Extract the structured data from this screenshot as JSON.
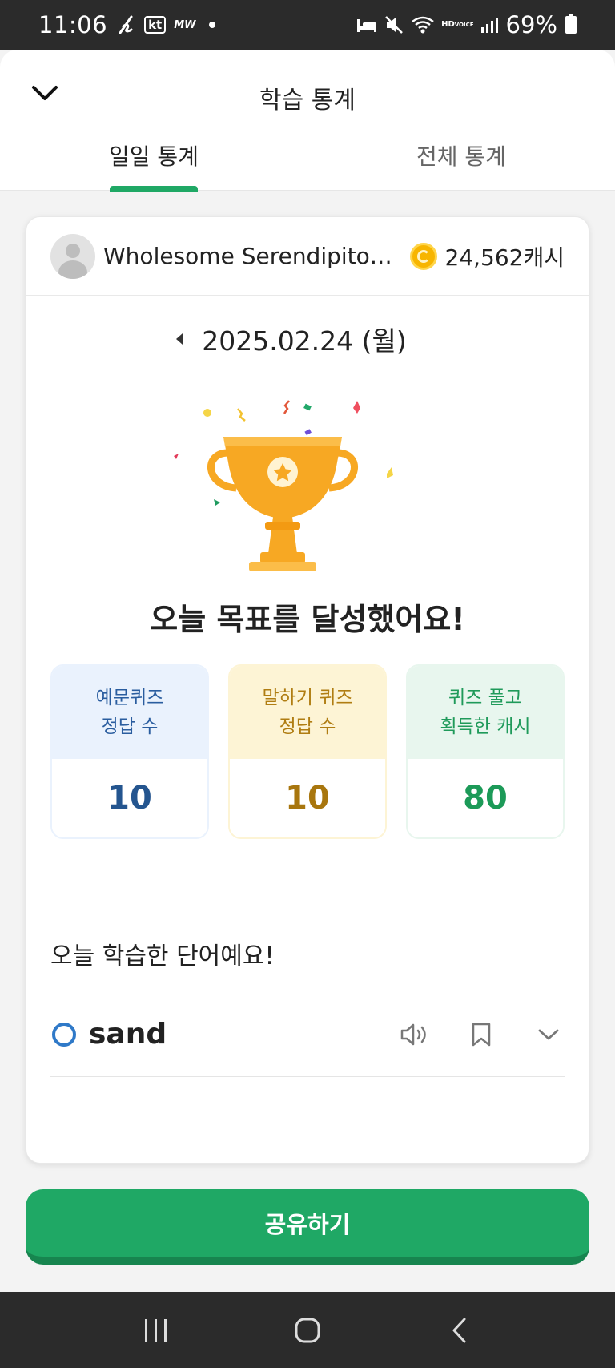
{
  "status_bar": {
    "time": "11:06",
    "carrier": "kt",
    "carrier_sub": "MW",
    "battery": "69%",
    "hd_top": "HD",
    "hd_bottom": "VOICE",
    "icons": [
      "signature-icon",
      "sleep-mode-icon",
      "mute-icon",
      "wifi-icon",
      "signal-icon",
      "battery-icon"
    ]
  },
  "header": {
    "title": "학습 통계",
    "collapse_icon": "chevron-down-icon",
    "tabs": [
      {
        "label": "일일 통계",
        "active": true
      },
      {
        "label": "전체 통계",
        "active": false
      }
    ]
  },
  "card": {
    "user_name": "Wholesome Serendipitous...",
    "cash": "24,562캐시",
    "date": "2025.02.24 (월)",
    "goal_text": "오늘 목표를 달성했어요!",
    "stats": [
      {
        "line1": "예문퀴즈",
        "line2": "정답 수",
        "value": "10",
        "color": "#24558f"
      },
      {
        "line1": "말하기 퀴즈",
        "line2": "정답 수",
        "value": "10",
        "color": "#a8760e"
      },
      {
        "line1": "퀴즈 풀고",
        "line2": "획득한 캐시",
        "value": "80",
        "color": "#1c9a58"
      }
    ],
    "words_title": "오늘 학습한 단어예요!",
    "words": [
      {
        "word": "sand",
        "actions": [
          "speaker-icon",
          "bookmark-icon",
          "chevron-down-icon"
        ]
      }
    ]
  },
  "share_button": "공유하기",
  "nav_bar": [
    "recent-apps-icon",
    "home-icon",
    "back-icon"
  ],
  "colors": {
    "accent": "#1fa865",
    "trophy": "#f7a823"
  }
}
